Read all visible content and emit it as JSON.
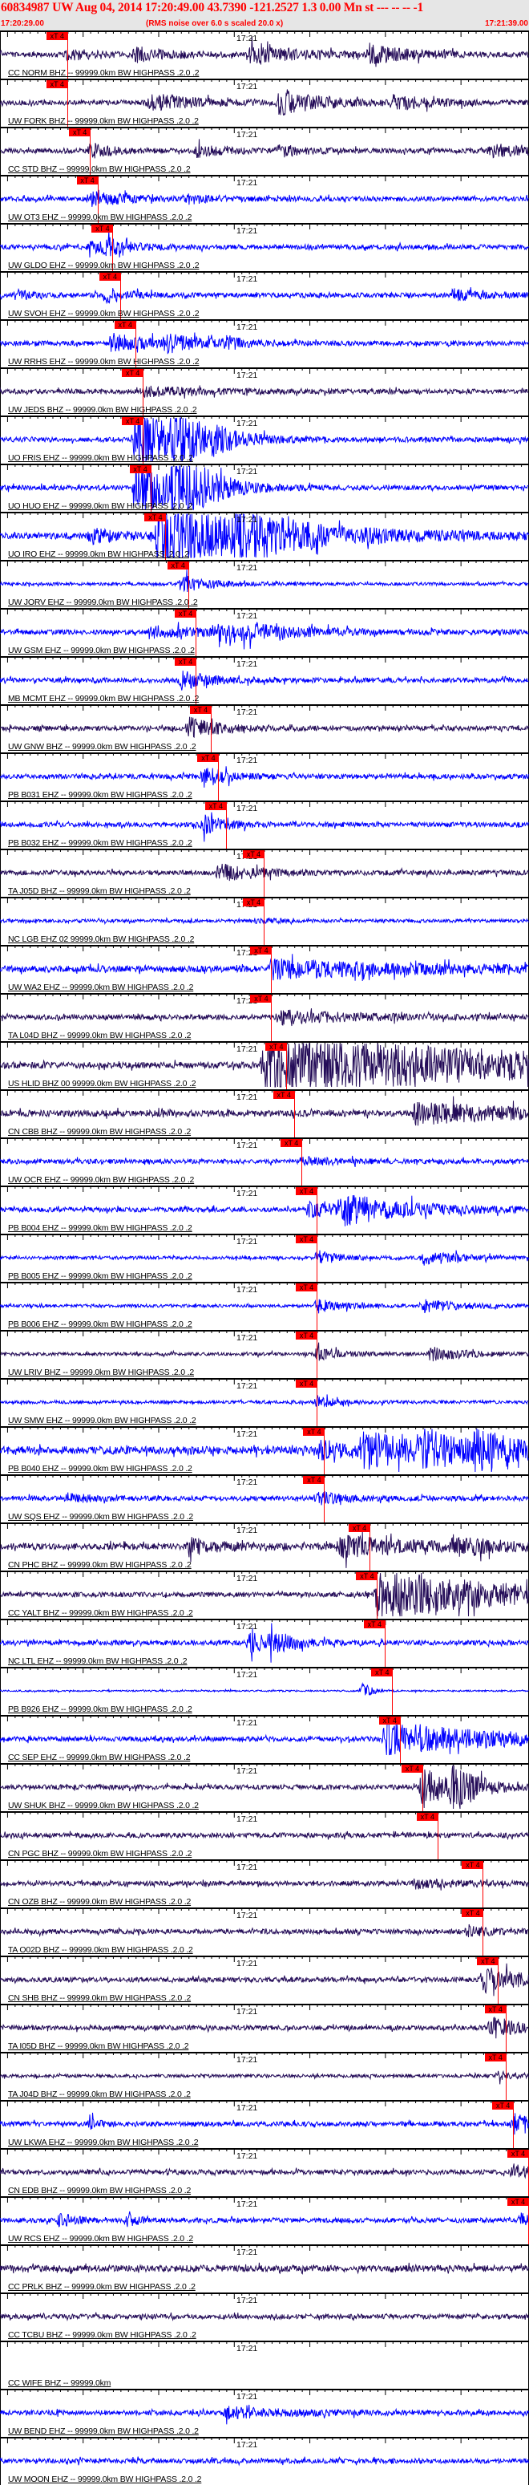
{
  "header": {
    "title": "60834987 UW Aug 04, 2014 17:20:49.00    43.7390 -121.2527  1.3 0.00 Mn st --- -- --  -1",
    "start_time": "17:20:29.00",
    "rms_note": "(RMS noise over 6.0 s scaled 20.0 x)",
    "end_time": "17:21:39.00"
  },
  "axis": {
    "minute_label": "17:21",
    "window_seconds": 70,
    "minute_offset_s": 31
  },
  "pick_label": "xT 4",
  "colors": {
    "dark": "#240c58",
    "blue": "#0000ff",
    "pick": "#ff0000",
    "header_text": "#ff0000"
  },
  "traces": [
    {
      "label": "CC NORM BHZ -- 99999.0km BW  HIGHPASS .2.0 .2",
      "color": "dark",
      "noise": 3,
      "pick": 9,
      "bursts": [
        [
          9,
          6,
          4
        ],
        [
          18,
          8,
          5
        ],
        [
          33,
          12,
          6
        ],
        [
          49,
          10,
          6
        ]
      ]
    },
    {
      "label": "UW FORK BHZ -- 99999.0km BW  HIGHPASS .2.0 .2",
      "color": "dark",
      "noise": 3,
      "pick": 9,
      "bursts": [
        [
          20,
          10,
          6
        ],
        [
          37,
          14,
          6
        ],
        [
          52,
          8,
          5
        ]
      ]
    },
    {
      "label": "CC STD BHZ -- 99999.0km BW  HIGHPASS .2.0 .2",
      "color": "dark",
      "noise": 3,
      "pick": 12,
      "bursts": [
        [
          12,
          8,
          3
        ],
        [
          26,
          6,
          4
        ],
        [
          37,
          6,
          3
        ],
        [
          65,
          8,
          4
        ]
      ]
    },
    {
      "label": "UW OT3 EHZ -- 99999.0km BW  HIGHPASS .2.0 .2",
      "color": "blue",
      "noise": 3,
      "pick": 13,
      "bursts": [
        [
          12,
          10,
          4
        ],
        [
          25,
          4,
          4
        ]
      ]
    },
    {
      "label": "UW GLDO EHZ -- 99999.0km BW  HIGHPASS .2.0 .2",
      "color": "blue",
      "noise": 3,
      "pick": 15,
      "bursts": [
        [
          12,
          6,
          3
        ],
        [
          14,
          8,
          3
        ]
      ]
    },
    {
      "label": "UW SVOH EHZ -- 99999.0km BW  HIGHPASS .2.0 .2",
      "color": "blue",
      "noise": 3,
      "pick": 16,
      "bursts": [
        [
          2,
          6,
          2
        ],
        [
          14,
          8,
          3
        ],
        [
          60,
          6,
          4
        ]
      ]
    },
    {
      "label": "UW RRHS EHZ -- 99999.0km BW  HIGHPASS .2.0 .2",
      "color": "blue",
      "noise": 3,
      "pick": 18,
      "bursts": [
        [
          15,
          10,
          6
        ],
        [
          22,
          8,
          5
        ],
        [
          30,
          6,
          2
        ]
      ]
    },
    {
      "label": "UW JEDS BHZ -- 99999.0km BW  HIGHPASS .2.0 .2",
      "color": "dark",
      "noise": 3,
      "pick": 19,
      "bursts": [
        [
          19,
          5,
          8
        ]
      ]
    },
    {
      "label": "UO FRIS EHZ -- 99999.0km BW  HIGHPASS .2.0 .2",
      "color": "blue",
      "noise": 3,
      "pick": 19,
      "bursts": [
        [
          18,
          40,
          5
        ],
        [
          23,
          40,
          3
        ],
        [
          28,
          8,
          4
        ]
      ]
    },
    {
      "label": "UO HUO EHZ -- 99999.0km BW  HIGHPASS .2.0 .2",
      "color": "blue",
      "noise": 3,
      "pick": 20,
      "bursts": [
        [
          18,
          40,
          5
        ],
        [
          23,
          40,
          3
        ],
        [
          27,
          8,
          4
        ]
      ]
    },
    {
      "label": "UO IRO EHZ -- 99999.0km BW  HIGHPASS .2.0 .2",
      "color": "blue",
      "noise": 4,
      "pick": 22,
      "bursts": [
        [
          12,
          8,
          4
        ],
        [
          21,
          40,
          14
        ],
        [
          31,
          20,
          6
        ]
      ]
    },
    {
      "label": "UW JORV EHZ -- 99999.0km BW  HIGHPASS .2.0 .2",
      "color": "blue",
      "noise": 2,
      "pick": 25,
      "bursts": [
        [
          24,
          10,
          4
        ]
      ]
    },
    {
      "label": "UW GSM EHZ -- 99999.0km BW  HIGHPASS .2.0 .2",
      "color": "blue",
      "noise": 3,
      "pick": 26,
      "bursts": [
        [
          20,
          6,
          10
        ],
        [
          29,
          12,
          8
        ]
      ]
    },
    {
      "label": "MB MCMT EHZ -- 99999.0km BW  HIGHPASS .2.0 .2",
      "color": "blue",
      "noise": 3,
      "pick": 26,
      "bursts": [
        [
          24,
          10,
          4
        ]
      ]
    },
    {
      "label": "UW GNW BHZ -- 99999.0km BW  HIGHPASS .2.0 .2",
      "color": "dark",
      "noise": 3,
      "pick": 28,
      "bursts": [
        [
          25,
          12,
          4
        ]
      ]
    },
    {
      "label": "PB B031 EHZ -- 99999.0km BW  HIGHPASS .2.0 .2",
      "color": "blue",
      "noise": 3,
      "pick": 29,
      "bursts": [
        [
          27,
          12,
          3
        ]
      ]
    },
    {
      "label": "PB B032 EHZ -- 99999.0km BW  HIGHPASS .2.0 .2",
      "color": "blue",
      "noise": 3,
      "pick": 30,
      "bursts": [
        [
          27,
          10,
          3
        ]
      ]
    },
    {
      "label": "TA J05D BHZ -- 99999.0km BW  HIGHPASS .2.0 .2",
      "color": "dark",
      "noise": 3,
      "pick": 35,
      "bursts": [
        [
          29,
          10,
          5
        ]
      ]
    },
    {
      "label": "NC LGB EHZ 02 99999.0km BW  HIGHPASS .2.0 .2",
      "color": "blue",
      "noise": 2,
      "pick": 35,
      "bursts": [
        [
          34,
          3,
          3
        ]
      ]
    },
    {
      "label": "UW WA2 EHZ -- 99999.0km BW  HIGHPASS .2.0 .2",
      "color": "blue",
      "noise": 4,
      "pick": 36,
      "bursts": [
        [
          36,
          10,
          20
        ]
      ]
    },
    {
      "label": "TA L04D BHZ -- 99999.0km BW  HIGHPASS .2.0 .2",
      "color": "dark",
      "noise": 3,
      "pick": 36,
      "bursts": [
        [
          37,
          8,
          10
        ]
      ]
    },
    {
      "label": "US HLID BHZ 00 99999.0km BW  HIGHPASS .2.0 .2",
      "color": "dark",
      "noise": 4,
      "pick": 38,
      "bursts": [
        [
          35,
          35,
          40
        ]
      ]
    },
    {
      "label": "CN CBB BHZ -- 99999.0km BW  HIGHPASS .2.0 .2",
      "color": "dark",
      "noise": 4,
      "pick": 39,
      "bursts": [
        [
          55,
          12,
          15
        ]
      ]
    },
    {
      "label": "UW OCR EHZ -- 99999.0km BW  HIGHPASS .2.0 .2",
      "color": "blue",
      "noise": 3,
      "pick": 40,
      "bursts": [
        [
          40,
          4,
          5
        ]
      ]
    },
    {
      "label": "PB B004 EHZ -- 99999.0km BW  HIGHPASS .2.0 .2",
      "color": "blue",
      "noise": 3,
      "pick": 42,
      "bursts": [
        [
          41,
          8,
          5
        ],
        [
          45,
          16,
          10
        ]
      ]
    },
    {
      "label": "PB B005 EHZ -- 99999.0km BW  HIGHPASS .2.0 .2",
      "color": "blue",
      "noise": 2,
      "pick": 42,
      "bursts": [
        [
          42,
          8,
          3
        ],
        [
          56,
          8,
          5
        ]
      ]
    },
    {
      "label": "PB B006 EHZ -- 99999.0km BW  HIGHPASS .2.0 .2",
      "color": "blue",
      "noise": 2,
      "pick": 42,
      "bursts": [
        [
          42,
          8,
          3
        ],
        [
          56,
          8,
          5
        ]
      ]
    },
    {
      "label": "UW LRIV BHZ -- 99999.0km BW  HIGHPASS .2.0 .2",
      "color": "dark",
      "noise": 2,
      "pick": 42,
      "bursts": [
        [
          42,
          8,
          3
        ],
        [
          57,
          8,
          5
        ]
      ]
    },
    {
      "label": "UW SMW EHZ -- 99999.0km BW  HIGHPASS .2.0 .2",
      "color": "blue",
      "noise": 2,
      "pick": 42,
      "bursts": [
        [
          42,
          6,
          3
        ]
      ]
    },
    {
      "label": "PB B040 EHZ -- 99999.0km BW  HIGHPASS .2.0 .2",
      "color": "blue",
      "noise": 5,
      "pick": 43,
      "bursts": [
        [
          42,
          10,
          5
        ],
        [
          48,
          20,
          8
        ],
        [
          56,
          18,
          6
        ],
        [
          63,
          18,
          5
        ]
      ]
    },
    {
      "label": "UW SQS EHZ -- 99999.0km BW  HIGHPASS .2.0 .2",
      "color": "blue",
      "noise": 3,
      "pick": 43,
      "bursts": [
        [
          9,
          5,
          3
        ],
        [
          42,
          8,
          3
        ]
      ]
    },
    {
      "label": "CN PHC BHZ -- 99999.0km BW  HIGHPASS .2.0 .2",
      "color": "dark",
      "noise": 4,
      "pick": 49,
      "bursts": [
        [
          25,
          10,
          4
        ],
        [
          45,
          12,
          10
        ],
        [
          60,
          10,
          5
        ]
      ]
    },
    {
      "label": "CC YALT BHZ -- 99999.0km BW  HIGHPASS .2.0 .2",
      "color": "dark",
      "noise": 3,
      "pick": 50,
      "bursts": [
        [
          50,
          30,
          18
        ]
      ]
    },
    {
      "label": "NC LTL EHZ -- 99999.0km BW  HIGHPASS .2.0 .2",
      "color": "blue",
      "noise": 3,
      "pick": 51,
      "bursts": [
        [
          33,
          12,
          3
        ],
        [
          36,
          12,
          3
        ]
      ]
    },
    {
      "label": "PB B926 EHZ -- 99999.0km BW  HIGHPASS .2.0 .2",
      "color": "blue",
      "noise": 1,
      "pick": 52,
      "bursts": [
        [
          48,
          12,
          1
        ]
      ]
    },
    {
      "label": "CC SEP EHZ -- 99999.0km BW  HIGHPASS .2.0 .2",
      "color": "blue",
      "noise": 3,
      "pick": 53,
      "bursts": [
        [
          51,
          20,
          15
        ]
      ]
    },
    {
      "label": "UW SHUK BHZ -- 99999.0km BW  HIGHPASS .2.0 .2",
      "color": "dark",
      "noise": 3,
      "pick": 56,
      "bursts": [
        [
          56,
          28,
          3
        ],
        [
          60,
          28,
          3
        ]
      ]
    },
    {
      "label": "CN PGC BHZ -- 99999.0km BW  HIGHPASS .2.0 .2",
      "color": "dark",
      "noise": 3,
      "pick": 58,
      "bursts": []
    },
    {
      "label": "CN OZB BHZ -- 99999.0km BW  HIGHPASS .2.0 .2",
      "color": "dark",
      "noise": 3,
      "pick": 64,
      "bursts": [
        [
          55,
          5,
          5
        ]
      ]
    },
    {
      "label": "TA O02D BHZ -- 99999.0km BW  HIGHPASS .2.0 .2",
      "color": "dark",
      "noise": 3,
      "pick": 64,
      "bursts": [
        [
          62,
          5,
          4
        ]
      ]
    },
    {
      "label": "CN SHB BHZ -- 99999.0km BW  HIGHPASS .2.0 .2",
      "color": "dark",
      "noise": 3,
      "pick": 66,
      "bursts": [
        [
          64,
          15,
          6
        ]
      ]
    },
    {
      "label": "TA I05D BHZ -- 99999.0km BW  HIGHPASS .2.0 .2",
      "color": "dark",
      "noise": 3,
      "pick": 67,
      "bursts": [
        [
          65,
          12,
          5
        ]
      ]
    },
    {
      "label": "TA J04D BHZ -- 99999.0km BW  HIGHPASS .2.0 .2",
      "color": "dark",
      "noise": 2,
      "pick": 67,
      "bursts": [
        [
          66,
          5,
          2
        ]
      ]
    },
    {
      "label": "UW LKWA EHZ -- 99999.0km BW  HIGHPASS .2.0 .2",
      "color": "blue",
      "noise": 3,
      "pick": 68,
      "bursts": [
        [
          68,
          12,
          3
        ],
        [
          12,
          8,
          1
        ]
      ]
    },
    {
      "label": "CN EDB BHZ -- 99999.0km BW  HIGHPASS .2.0 .2",
      "color": "dark",
      "noise": 3,
      "pick": 70,
      "bursts": [
        [
          68,
          8,
          3
        ]
      ]
    },
    {
      "label": "UW RCS EHZ -- 99999.0km BW  HIGHPASS .2.0 .2",
      "color": "blue",
      "noise": 3,
      "pick": 70,
      "bursts": [
        [
          8,
          8,
          2
        ],
        [
          17,
          10,
          1
        ],
        [
          69,
          8,
          2
        ]
      ]
    },
    {
      "label": "CC PRLK BHZ -- 99999.0km BW  HIGHPASS .2.0 .2",
      "color": "dark",
      "noise": 4,
      "pick": null,
      "bursts": []
    },
    {
      "label": "CC TCBU BHZ -- 99999.0km BW  HIGHPASS .2.0 .2",
      "color": "dark",
      "noise": 3,
      "pick": null,
      "bursts": []
    },
    {
      "label": "CC WIFE BHZ -- 99999.0km",
      "color": "none",
      "noise": 0,
      "pick": null,
      "bursts": []
    },
    {
      "label": "UW BEND EHZ -- 99999.0km BW  HIGHPASS .2.0 .2",
      "color": "blue",
      "noise": 3,
      "pick": null,
      "bursts": [
        [
          30,
          6,
          8
        ]
      ]
    },
    {
      "label": "UW MOON EHZ -- 99999.0km BW  HIGHPASS .2.0 .2",
      "color": "blue",
      "noise": 3,
      "pick": null,
      "bursts": []
    }
  ]
}
